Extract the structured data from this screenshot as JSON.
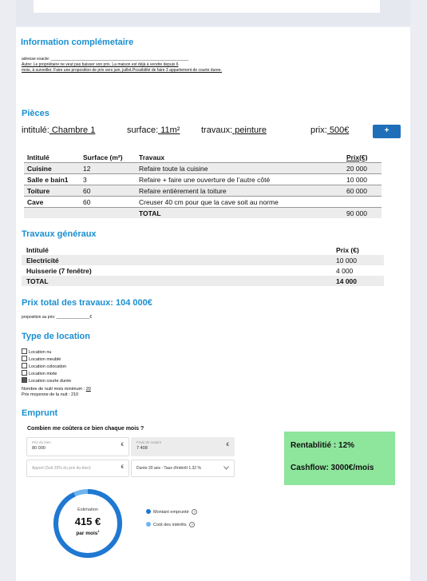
{
  "info": {
    "title": "Information complémetaire",
    "address_label": "adresse exacte: ______________________________________________________________",
    "note_line1": "Autre: Le propriétaire ne veut pas baisser son prix. La maison est déjà à vendre depuis 6",
    "note_line2": " mois, à surveiller. Faire une proposition de prix vers juin, juillet.Possibilité de faire 3 appartement de courte duree."
  },
  "pieces": {
    "title": "Pièces",
    "intitule_label": "intitulé:",
    "intitule_value": " Chambre 1",
    "surface_label": "surface:",
    "surface_value": " 11m²",
    "travaux_label": "travaux:",
    "travaux_value": " peinture",
    "prix_label": "prix:",
    "prix_value": " 500€",
    "add_button": "+",
    "headers": [
      "Intitulé",
      "Surface (m²)",
      "Travaux",
      "Prix(€)"
    ],
    "rows": [
      {
        "name": "Cuisine",
        "surface": "12",
        "travaux": "Refaire toute la cuisine",
        "prix": "20 000"
      },
      {
        "name": "Salle e bain1",
        "surface": "3",
        "travaux": "Refaire + faire une ouverture de l’autre côté",
        "prix": "10 000"
      },
      {
        "name": "Toiture",
        "surface": "60",
        "travaux": "Refaire entièrement la toiture",
        "prix": "60 000"
      },
      {
        "name": "Cave",
        "surface": "60",
        "travaux": "Creuser 40 cm pour que la cave soit au norme",
        "prix": ""
      }
    ],
    "total_label": "TOTAL",
    "total_value": "90 000"
  },
  "travaux": {
    "title": "Travaux généraux",
    "header_name": "Intitulé",
    "header_price": "Prix (€)",
    "rows": [
      {
        "name": "Electricité",
        "prix": "10 000"
      },
      {
        "name": "Huisserie (7 fenêtre)",
        "prix": "4 000"
      }
    ],
    "total_label": "TOTAL",
    "total_value": "14 000"
  },
  "total": {
    "title": "Prix total des travaux: 104 000€",
    "proposition": "proposition au prix: _______________€"
  },
  "location": {
    "title": "Type de location",
    "options": [
      {
        "label": "Location nu",
        "checked": false
      },
      {
        "label": "Location meublé",
        "checked": false
      },
      {
        "label": "Location colocation",
        "checked": false
      },
      {
        "label": "Location mixte",
        "checked": false
      },
      {
        "label": "Location courte durée",
        "checked": true
      }
    ],
    "nuits_label": "Nombre de nuit/ mois minimum : ",
    "nuits_value": "20",
    "prix_nuit": "Prix moyenne de la nuit : 210"
  },
  "emprunt": {
    "title": "Emprunt",
    "question": "Combien me coûtera ce bien chaque mois ?",
    "prix_bien_label": "Prix du bien",
    "prix_bien_value": "80 000",
    "frais_label": "Frais de notaire",
    "frais_value": "7 408",
    "apport_placeholder": "Apport (Soit 20% du prix du bien)",
    "currency": "€",
    "duree": "Durée 20 ans - Taux d'intérêt 1.32 %",
    "estimation_label": "Estimation",
    "estimation_value": "415 €",
    "par_mois": "par mois",
    "par_mois_sup": "1",
    "legend_emprunte": "Montant emprunté",
    "legend_interets": "Coût des intérêts",
    "donut_fraction_emprunte": 0.93,
    "color_emprunte": "#1f78d1",
    "color_interets": "#6fb4ee"
  },
  "result": {
    "rentabilite": "Rentablitié : 12%",
    "cashflow": "Cashflow: 3000€/mois",
    "bg": "#8ee59c"
  }
}
